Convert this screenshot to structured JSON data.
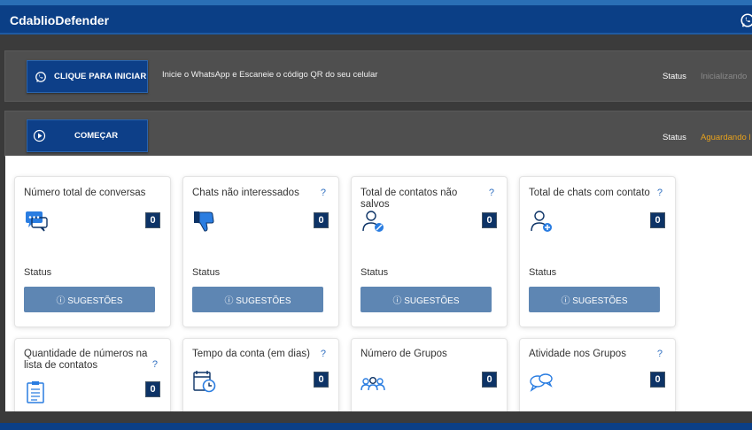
{
  "app": {
    "title": "CdablioDefender"
  },
  "panel1": {
    "button_label": "CLIQUE PARA INICIAR",
    "instruction": "Inicie o WhatsApp e Escaneie o código QR do seu celular",
    "status_label": "Status",
    "status_value": "Inicializando"
  },
  "panel2": {
    "button_label": "COMEÇAR",
    "status_label": "Status",
    "status_value": "Aguardando l"
  },
  "cards": [
    {
      "title": "Número total de conversas",
      "help": "",
      "value": "0",
      "status": "Status",
      "button": "ⓘ SUGESTÕES",
      "icon": "chat-bubbles-icon"
    },
    {
      "title": "Chats não interessados",
      "help": "?",
      "value": "0",
      "status": "Status",
      "button": "ⓘ SUGESTÕES",
      "icon": "thumbs-down-icon"
    },
    {
      "title": "Total de contatos não salvos",
      "help": "?",
      "value": "0",
      "status": "Status",
      "button": "ⓘ SUGESTÕES",
      "icon": "user-blocked-icon"
    },
    {
      "title": "Total de chats com contato",
      "help": "?",
      "value": "0",
      "status": "Status",
      "button": "ⓘ SUGESTÕES",
      "icon": "user-add-icon"
    },
    {
      "title": "Quantidade de números na lista de contatos",
      "help": "?",
      "value": "0",
      "icon": "clipboard-list-icon"
    },
    {
      "title": "Tempo da conta (em dias)",
      "help": "?",
      "value": "0",
      "icon": "calendar-clock-icon"
    },
    {
      "title": "Número de Grupos",
      "help": "",
      "value": "0",
      "icon": "group-icon"
    },
    {
      "title": "Atividade nos Grupos",
      "help": "?",
      "value": "0",
      "icon": "group-chat-icon"
    }
  ],
  "colors": {
    "header": "#0b3f86",
    "accent_button": "#5e86b3",
    "badge": "#0d3366",
    "status_waiting": "#e8a21c"
  }
}
